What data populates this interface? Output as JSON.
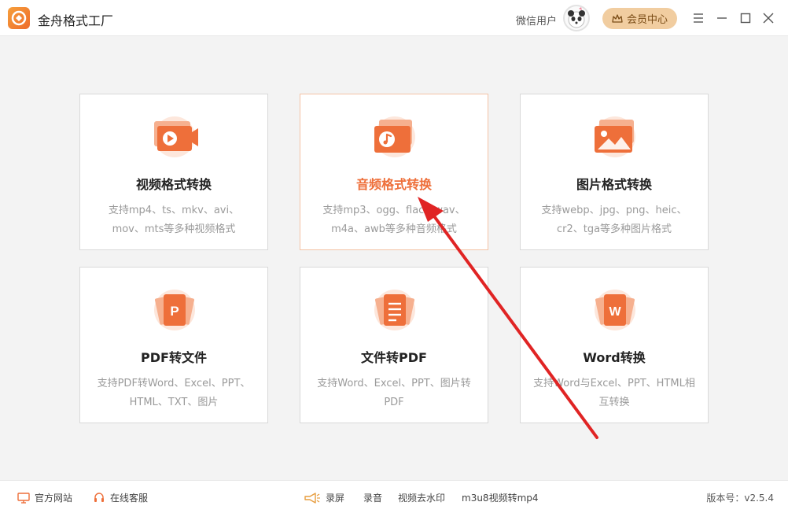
{
  "titlebar": {
    "app_title": "金舟格式工厂",
    "user_name": "微信用户",
    "vip_label": "会员中心",
    "icons": [
      "app-logo-icon",
      "avatar-panda-icon",
      "crown-icon",
      "menu-icon",
      "minimize-icon",
      "maximize-icon",
      "close-icon"
    ]
  },
  "cards": [
    {
      "title": "视频格式转换",
      "desc": "支持mp4、ts、mkv、avi、mov、mts等多种视频格式",
      "icon": "video-file-icon"
    },
    {
      "title": "音频格式转换",
      "desc": "支持mp3、ogg、flac、wav、m4a、awb等多种音频格式",
      "icon": "audio-file-icon"
    },
    {
      "title": "图片格式转换",
      "desc": "支持webp、jpg、png、heic、cr2、tga等多种图片格式",
      "icon": "image-file-icon"
    },
    {
      "title": "PDF转文件",
      "desc": "支持PDF转Word、Excel、PPT、HTML、TXT、图片",
      "icon": "pdf-file-icon"
    },
    {
      "title": "文件转PDF",
      "desc": "支持Word、Excel、PPT、图片转PDF",
      "icon": "document-file-icon"
    },
    {
      "title": "Word转换",
      "desc": "支持Word与Excel、PPT、HTML相互转换",
      "icon": "word-file-icon"
    }
  ],
  "icon_glyphs": {
    "pdf": "P",
    "word": "W"
  },
  "footer": {
    "website": "官方网站",
    "support": "在线客服",
    "screen_record": "录屏",
    "audio_record": "录音",
    "watermark": "视频去水印",
    "m3u8": "m3u8视频转mp4",
    "version": "版本号：v2.5.4"
  },
  "colors": {
    "accent": "#ee6f3a",
    "vip_bg": "#f1cda0",
    "arrow": "#e02424"
  }
}
